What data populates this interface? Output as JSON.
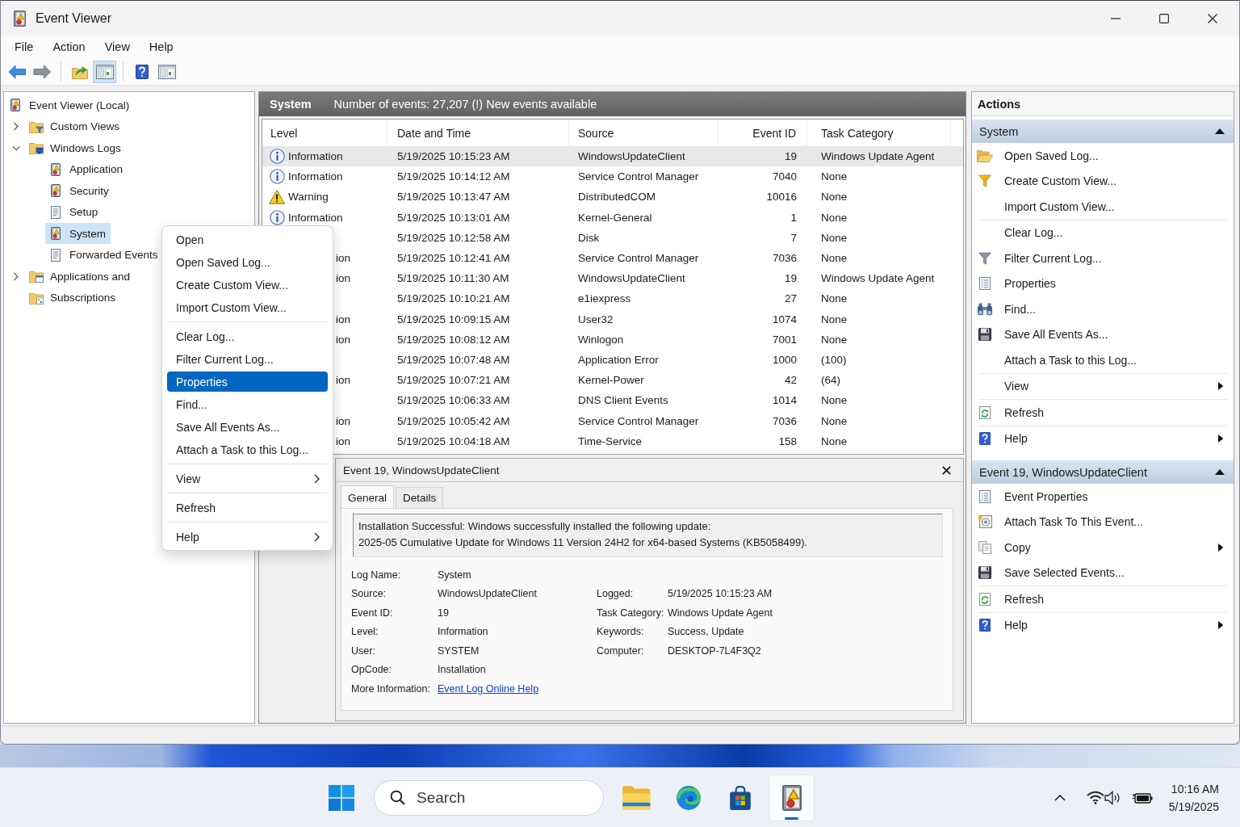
{
  "window": {
    "title": "Event Viewer"
  },
  "menu_bar": [
    "File",
    "Action",
    "View",
    "Help"
  ],
  "toolbar": [
    [
      {
        "kind": "back",
        "pressed": false
      },
      {
        "kind": "forward",
        "pressed": false
      }
    ],
    [
      {
        "kind": "up-folder",
        "pressed": false
      },
      {
        "kind": "console-tree",
        "pressed": true
      }
    ],
    [
      {
        "kind": "help",
        "pressed": false
      },
      {
        "kind": "action-pane",
        "pressed": false
      }
    ]
  ],
  "tree": [
    {
      "label": "Event Viewer (Local)",
      "kind": "log",
      "selected": false,
      "children": [
        {
          "label": "Custom Views",
          "kind": "filter-folder",
          "expanded": false,
          "selected": false
        },
        {
          "label": "Windows Logs",
          "kind": "logs-folder",
          "expanded": true,
          "selected": false,
          "children": [
            {
              "label": "Application",
              "kind": "log",
              "selected": false
            },
            {
              "label": "Security",
              "kind": "log",
              "selected": false
            },
            {
              "label": "Setup",
              "kind": "plain-log",
              "selected": false
            },
            {
              "label": "System",
              "kind": "log",
              "selected": true
            },
            {
              "label": "Forwarded Events",
              "kind": "plain-log",
              "selected": false
            }
          ]
        },
        {
          "label": "Applications and",
          "kind": "apps-folder",
          "expanded": false,
          "selected": false
        },
        {
          "label": "Subscriptions",
          "kind": "subs-folder",
          "selected": false
        }
      ]
    }
  ],
  "events": {
    "log_name": "System",
    "summary": "Number of events: 27,207 (!) New events available",
    "columns": [
      "Level",
      "Date and Time",
      "Source",
      "Event ID",
      "Task Category"
    ],
    "rows": [
      {
        "kind": "information",
        "level": "Information",
        "date": "5/19/2025 10:15:23 AM",
        "source": "WindowsUpdateClient",
        "event_id": "19",
        "task_category": "Windows Update Agent",
        "selected": true
      },
      {
        "kind": "information",
        "level": "Information",
        "date": "5/19/2025 10:14:12 AM",
        "source": "Service Control Manager",
        "event_id": "7040",
        "task_category": "None",
        "selected": false
      },
      {
        "kind": "warning",
        "level": "Warning",
        "date": "5/19/2025 10:13:47 AM",
        "source": "DistributedCOM",
        "event_id": "10016",
        "task_category": "None",
        "selected": false
      },
      {
        "kind": "information",
        "level": "Information",
        "date": "5/19/2025 10:13:01 AM",
        "source": "Kernel-General",
        "event_id": "1",
        "task_category": "None",
        "selected": false
      },
      {
        "kind": "covered",
        "date": "5/19/2025 10:12:58 AM",
        "source": "Disk",
        "event_id": "7",
        "task_category": "None",
        "selected": false
      },
      {
        "kind": "covered",
        "level": "ion",
        "date": "5/19/2025 10:12:41 AM",
        "source": "Service Control Manager",
        "event_id": "7036",
        "task_category": "None",
        "selected": false
      },
      {
        "kind": "covered",
        "level": "ion",
        "date": "5/19/2025 10:11:30 AM",
        "source": "WindowsUpdateClient",
        "event_id": "19",
        "task_category": "Windows Update Agent",
        "selected": false
      },
      {
        "kind": "covered",
        "date": "5/19/2025 10:10:21 AM",
        "source": "e1iexpress",
        "event_id": "27",
        "task_category": "None",
        "selected": false
      },
      {
        "kind": "covered",
        "level": "ion",
        "date": "5/19/2025 10:09:15 AM",
        "source": "User32",
        "event_id": "1074",
        "task_category": "None",
        "selected": false
      },
      {
        "kind": "covered",
        "level": "ion",
        "date": "5/19/2025 10:08:12 AM",
        "source": "Winlogon",
        "event_id": "7001",
        "task_category": "None",
        "selected": false
      },
      {
        "kind": "covered",
        "date": "5/19/2025 10:07:48 AM",
        "source": "Application Error",
        "event_id": "1000",
        "task_category": "(100)",
        "selected": false
      },
      {
        "kind": "covered",
        "level": "ion",
        "date": "5/19/2025 10:07:21 AM",
        "source": "Kernel-Power",
        "event_id": "42",
        "task_category": "(64)",
        "selected": false
      },
      {
        "kind": "covered",
        "date": "5/19/2025 10:06:33 AM",
        "source": "DNS Client Events",
        "event_id": "1014",
        "task_category": "None",
        "selected": false
      },
      {
        "kind": "covered",
        "level": "ion",
        "date": "5/19/2025 10:05:42 AM",
        "source": "Service Control Manager",
        "event_id": "7036",
        "task_category": "None",
        "selected": false
      },
      {
        "kind": "covered",
        "level": "ion",
        "date": "5/19/2025 10:04:18 AM",
        "source": "Time-Service",
        "event_id": "158",
        "task_category": "None",
        "selected": false
      }
    ]
  },
  "context_menu": {
    "groups": [
      [
        {
          "label": "Open",
          "selected": false,
          "submenu": false
        },
        {
          "label": "Open Saved Log...",
          "selected": false,
          "submenu": false
        },
        {
          "label": "Create Custom View...",
          "selected": false,
          "submenu": false
        },
        {
          "label": "Import Custom View...",
          "selected": false,
          "submenu": false
        }
      ],
      [
        {
          "label": "Clear Log...",
          "selected": false,
          "submenu": false
        },
        {
          "label": "Filter Current Log...",
          "selected": false,
          "submenu": false
        },
        {
          "label": "Properties",
          "selected": true,
          "submenu": false
        },
        {
          "label": "Find...",
          "selected": false,
          "submenu": false
        },
        {
          "label": "Save All Events As...",
          "selected": false,
          "submenu": false
        },
        {
          "label": "Attach a Task to this Log...",
          "selected": false,
          "submenu": false
        }
      ],
      [
        {
          "label": "View",
          "selected": false,
          "submenu": true
        }
      ],
      [
        {
          "label": "Refresh",
          "selected": false,
          "submenu": false
        }
      ],
      [
        {
          "label": "Help",
          "selected": false,
          "submenu": true
        }
      ]
    ]
  },
  "detail": {
    "title": "Event 19, WindowsUpdateClient",
    "tabs": [
      {
        "label": "General",
        "selected": true
      },
      {
        "label": "Details",
        "selected": false
      }
    ],
    "message": [
      "Installation Successful: Windows successfully installed the following update:",
      "2025-05 Cumulative Update for Windows 11 Version 24H2 for x64-based Systems (KB5058499)."
    ],
    "fields": [
      [
        {
          "label": "Log Name:",
          "value": "System",
          "kind": "text"
        },
        {
          "label": "Source:",
          "value": "WindowsUpdateClient",
          "kind": "text"
        },
        {
          "label": "Event ID:",
          "value": "19",
          "kind": "text"
        },
        {
          "label": "Level:",
          "value": "Information",
          "kind": "text"
        },
        {
          "label": "User:",
          "value": "SYSTEM",
          "kind": "text"
        },
        {
          "label": "OpCode:",
          "value": "Installation",
          "kind": "text"
        },
        {
          "label": "More Information:",
          "value": "Event Log Online Help",
          "kind": "link"
        }
      ],
      [
        {
          "label": "Logged:",
          "value": "5/19/2025 10:15:23 AM",
          "kind": "text"
        },
        {
          "label": "Task Category:",
          "value": "Windows Update Agent",
          "kind": "text"
        },
        {
          "label": "Keywords:",
          "value": "Success, Update",
          "kind": "text"
        },
        {
          "label": "Computer:",
          "value": "DESKTOP-7L4F3Q2",
          "kind": "text"
        }
      ]
    ]
  },
  "actions": {
    "title": "Actions",
    "sections": [
      {
        "title": "System",
        "expanded": true,
        "groups": [
          [
            {
              "label": "Open Saved Log...",
              "kind": "open-folder",
              "submenu": false
            },
            {
              "label": "Create Custom View...",
              "kind": "create-filter",
              "submenu": false
            },
            {
              "label": "Import Custom View...",
              "submenu": false
            }
          ],
          [
            {
              "label": "Clear Log...",
              "submenu": false
            },
            {
              "label": "Filter Current Log...",
              "kind": "filter",
              "submenu": false
            },
            {
              "label": "Properties",
              "kind": "properties",
              "submenu": false
            },
            {
              "label": "Find...",
              "kind": "find",
              "submenu": false
            },
            {
              "label": "Save All Events As...",
              "kind": "save",
              "submenu": false
            },
            {
              "label": "Attach a Task to this Log...",
              "submenu": false
            }
          ],
          [
            {
              "label": "View",
              "submenu": true
            }
          ],
          [
            {
              "label": "Refresh",
              "kind": "refresh",
              "submenu": false
            }
          ],
          [
            {
              "label": "Help",
              "kind": "help",
              "submenu": true
            }
          ]
        ]
      },
      {
        "title": "Event 19, WindowsUpdateClient",
        "expanded": true,
        "groups": [
          [
            {
              "label": "Event Properties",
              "kind": "properties",
              "submenu": false
            },
            {
              "label": "Attach Task To This Event...",
              "kind": "attach-task",
              "submenu": false
            },
            {
              "label": "Copy",
              "kind": "copy",
              "submenu": true
            },
            {
              "label": "Save Selected Events...",
              "kind": "save",
              "submenu": false
            }
          ],
          [
            {
              "label": "Refresh",
              "kind": "refresh",
              "submenu": false
            }
          ],
          [
            {
              "label": "Help",
              "kind": "help",
              "submenu": true
            }
          ]
        ]
      }
    ]
  },
  "taskbar": {
    "search": {
      "placeholder": "Search"
    },
    "apps": [
      {
        "kind": "file-explorer",
        "active": false
      },
      {
        "kind": "browser",
        "active": false
      },
      {
        "kind": "store",
        "active": false
      },
      {
        "kind": "event-viewer",
        "active": true
      }
    ],
    "clock": {
      "time": "10:16 AM",
      "date": "5/19/2025"
    }
  }
}
